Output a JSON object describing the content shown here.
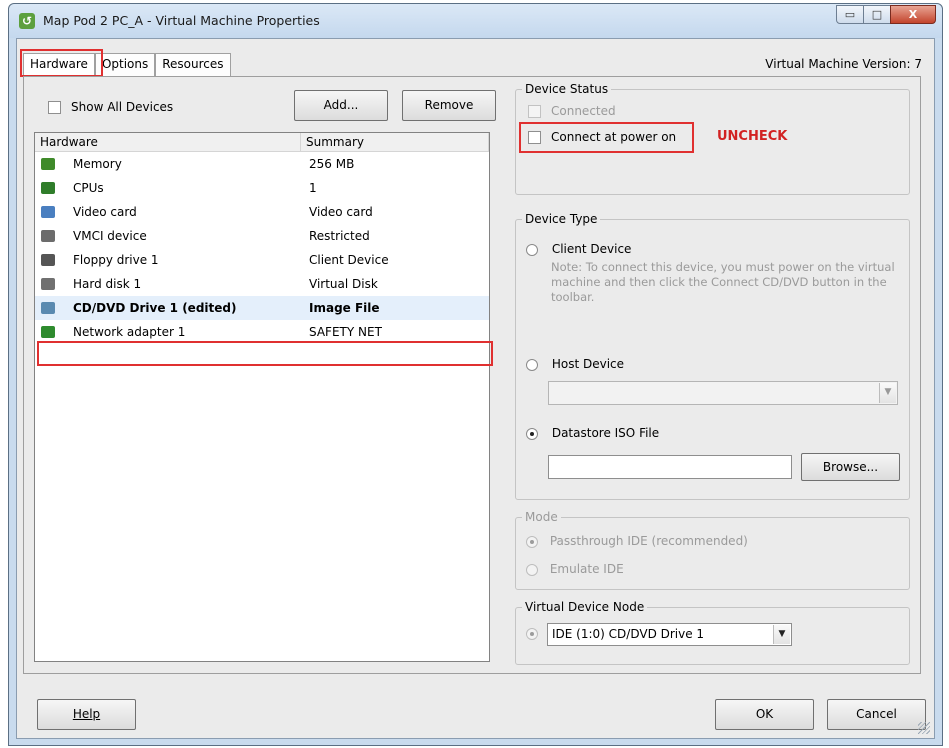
{
  "window": {
    "title": "Map Pod 2 PC_A - Virtual Machine Properties",
    "minimize_glyph": "▭",
    "maximize_glyph": "□",
    "close_glyph": "X"
  },
  "tabs": [
    {
      "label": "Hardware"
    },
    {
      "label": "Options"
    },
    {
      "label": "Resources"
    }
  ],
  "vm_version": "Virtual Machine Version: 7",
  "toolbar": {
    "show_all_devices_label": "Show All Devices",
    "add_label": "Add...",
    "remove_label": "Remove"
  },
  "hardware_list": {
    "columns": [
      "Hardware",
      "Summary"
    ],
    "rows": [
      {
        "name": "Memory",
        "summary": "256 MB",
        "icon": "memory-icon",
        "color": "#3f8a2a"
      },
      {
        "name": "CPUs",
        "summary": "1",
        "icon": "cpu-icon",
        "color": "#2f7d2a"
      },
      {
        "name": "Video card",
        "summary": "Video card",
        "icon": "monitor-icon",
        "color": "#4a7fc0"
      },
      {
        "name": "VMCI device",
        "summary": "Restricted",
        "icon": "device-icon",
        "color": "#6c6c6c"
      },
      {
        "name": "Floppy drive 1",
        "summary": "Client Device",
        "icon": "floppy-icon",
        "color": "#555555"
      },
      {
        "name": "Hard disk 1",
        "summary": "Virtual Disk",
        "icon": "disk-icon",
        "color": "#707070"
      },
      {
        "name": "CD/DVD Drive 1 (edited)",
        "summary": "Image File",
        "icon": "cd-drive-icon",
        "color": "#5a8ab0",
        "selected": true
      },
      {
        "name": "Network adapter 1",
        "summary": "SAFETY NET",
        "icon": "network-icon",
        "color": "#2e8b2e"
      }
    ]
  },
  "device_status": {
    "legend": "Device Status",
    "connected_label": "Connected",
    "connect_power_label": "Connect at power on",
    "annotation": "UNCHECK"
  },
  "device_type": {
    "legend": "Device Type",
    "client_label": "Client Device",
    "client_note": "Note: To connect this device, you must power on the virtual machine and then click the Connect CD/DVD button in the toolbar.",
    "host_label": "Host Device",
    "host_value": "",
    "iso_label": "Datastore ISO File",
    "iso_value": "",
    "browse_label": "Browse..."
  },
  "mode": {
    "legend": "Mode",
    "passthrough_label": "Passthrough IDE (recommended)",
    "emulate_label": "Emulate IDE"
  },
  "vdn": {
    "legend": "Virtual Device Node",
    "selected": "IDE (1:0) CD/DVD Drive 1"
  },
  "footer": {
    "help_label": "Help",
    "ok_label": "OK",
    "cancel_label": "Cancel"
  },
  "colors": {
    "annotation_red": "#e03030",
    "selected_row": "#e4effb"
  }
}
